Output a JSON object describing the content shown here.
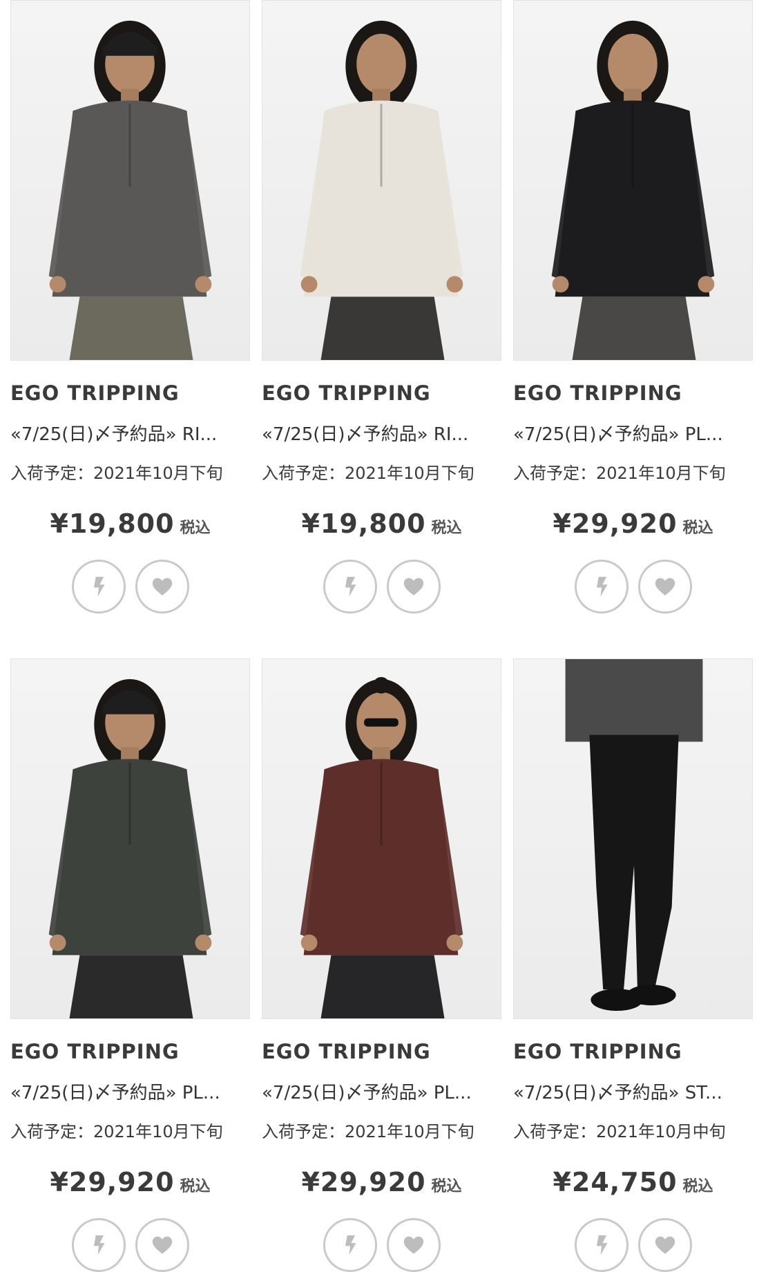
{
  "products": [
    {
      "brand": "EGO TRIPPING",
      "title": "«7/25(日)〆予約品» RI...",
      "arrival": "入荷予定：2021年10月下旬",
      "price": "¥19,800",
      "tax_label": "税込",
      "image": {
        "subject": "model-grey-halfzip-sweater",
        "garment_color": "#5a5856",
        "pants_color": "#6b6a5c",
        "hat": "beanie"
      }
    },
    {
      "brand": "EGO TRIPPING",
      "title": "«7/25(日)〆予約品» RI...",
      "arrival": "入荷予定：2021年10月下旬",
      "price": "¥19,800",
      "tax_label": "税込",
      "image": {
        "subject": "model-ivory-halfzip-sweater",
        "garment_color": "#e7e3da",
        "pants_color": "#3a3836",
        "hat": "none"
      }
    },
    {
      "brand": "EGO TRIPPING",
      "title": "«7/25(日)〆予約品» PL...",
      "arrival": "入荷予定：2021年10月下旬",
      "price": "¥29,920",
      "tax_label": "税込",
      "image": {
        "subject": "model-black-hooded-jacket",
        "garment_color": "#1c1c1e",
        "pants_color": "#4a4846",
        "hat": "none"
      }
    },
    {
      "brand": "EGO TRIPPING",
      "title": "«7/25(日)〆予約品» PL...",
      "arrival": "入荷予定：2021年10月下旬",
      "price": "¥29,920",
      "tax_label": "税込",
      "image": {
        "subject": "model-olive-shirt-jacket",
        "garment_color": "#3e423d",
        "pants_color": "#2a2a2a",
        "hat": "beanie"
      }
    },
    {
      "brand": "EGO TRIPPING",
      "title": "«7/25(日)〆予約品» PL...",
      "arrival": "入荷予定：2021年10月下旬",
      "price": "¥29,920",
      "tax_label": "税込",
      "image": {
        "subject": "model-brown-shirt-jacket",
        "garment_color": "#5e2f2a",
        "pants_color": "#262628",
        "hat": "topknot"
      }
    },
    {
      "brand": "EGO TRIPPING",
      "title": "«7/25(日)〆予約品» ST...",
      "arrival": "入荷予定：2021年10月中旬",
      "price": "¥24,750",
      "tax_label": "税込",
      "image": {
        "subject": "model-black-slim-pants",
        "garment_color": "#161616",
        "pants_color": "#161616",
        "hat": "none"
      }
    }
  ],
  "icons": {
    "quick_buy": "lightning-icon",
    "favorite": "heart-icon"
  },
  "colors": {
    "icon_grey": "#bdbdbd",
    "button_border": "#c9c9c9",
    "text_dark": "#333333"
  }
}
